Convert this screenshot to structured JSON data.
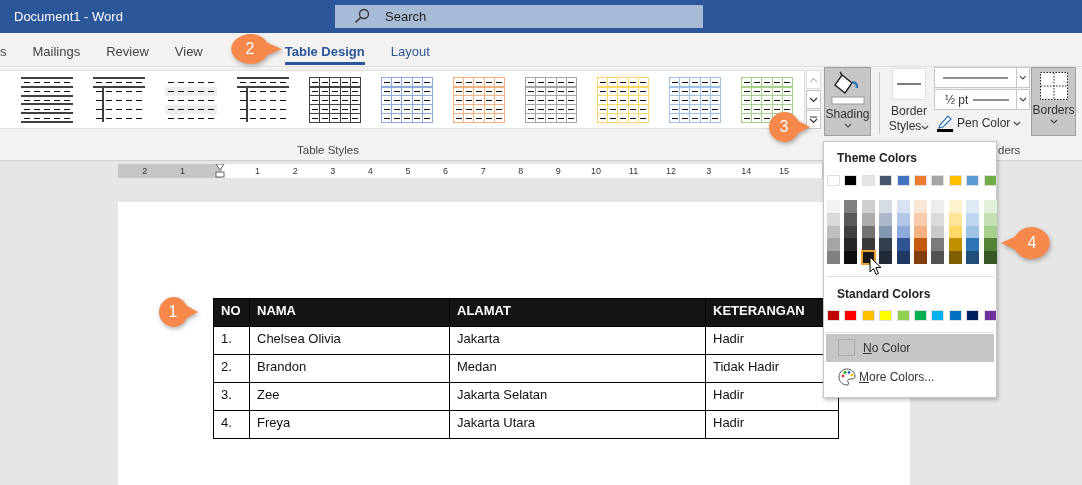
{
  "window": {
    "title": "Document1 - Word"
  },
  "search": {
    "placeholder": "Search"
  },
  "tabs": [
    {
      "label": "s",
      "selected": false,
      "contextual": false
    },
    {
      "label": "Mailings",
      "selected": false,
      "contextual": false
    },
    {
      "label": "Review",
      "selected": false,
      "contextual": false
    },
    {
      "label": "View",
      "selected": false,
      "contextual": false
    },
    {
      "label": "Table Design",
      "selected": true,
      "contextual": true
    },
    {
      "label": "Layout",
      "selected": false,
      "contextual": true
    }
  ],
  "ribbon": {
    "table_styles": {
      "label": "Table Styles",
      "gallery": [
        {
          "kind": "lines",
          "color": "#404040"
        },
        {
          "kind": "header-rule",
          "color": "#404040"
        },
        {
          "kind": "banded",
          "color": "#eeeeee"
        },
        {
          "kind": "header-rule",
          "color": "#404040"
        },
        {
          "kind": "grid",
          "color": "#404040"
        },
        {
          "kind": "grid",
          "color": "#8eaadb"
        },
        {
          "kind": "grid",
          "color": "#f4b183"
        },
        {
          "kind": "grid",
          "color": "#a5a5a5"
        },
        {
          "kind": "grid",
          "color": "#ffd966"
        },
        {
          "kind": "grid",
          "color": "#9dc3e6"
        },
        {
          "kind": "grid",
          "color": "#a8d08d"
        }
      ]
    },
    "shading": {
      "label": "Shading",
      "pressed": true
    },
    "border_styles": {
      "label": "Border Styles"
    },
    "pen_weight": "½ pt",
    "pen_color": {
      "label": "Pen Color"
    },
    "borders": {
      "label": "Borders",
      "pressed": true
    },
    "borders_group_label": "ders"
  },
  "ruler": {
    "numbers": [
      "2",
      "1",
      "1",
      "2",
      "3",
      "4",
      "5",
      "6",
      "7",
      "8",
      "9",
      "10",
      "11",
      "12",
      "3",
      "14",
      "15"
    ]
  },
  "table": {
    "columns": [
      "NO",
      "NAMA",
      "ALAMAT",
      "KETERANGAN"
    ],
    "rows": [
      [
        "1.",
        "Chelsea Olivia",
        "Jakarta",
        "Hadir"
      ],
      [
        "2.",
        "Brandon",
        "Medan",
        "Tidak Hadir"
      ],
      [
        "3.",
        "Zee",
        "Jakarta Selatan",
        "Hadir"
      ],
      [
        "4.",
        "Freya",
        "Jakarta Utara",
        "Hadir"
      ]
    ]
  },
  "shading_menu": {
    "theme_title": "Theme Colors",
    "theme_colors": [
      {
        "color": "#ffffff",
        "selected": false,
        "shades": [
          {
            "color": "#f2f2f2",
            "selected": false
          },
          {
            "color": "#d9d9d9",
            "selected": false
          },
          {
            "color": "#bfbfbf",
            "selected": false
          },
          {
            "color": "#a6a6a6",
            "selected": false
          },
          {
            "color": "#808080",
            "selected": false
          }
        ]
      },
      {
        "color": "#000000",
        "selected": false,
        "shades": [
          {
            "color": "#808080",
            "selected": false
          },
          {
            "color": "#595959",
            "selected": false
          },
          {
            "color": "#404040",
            "selected": false
          },
          {
            "color": "#262626",
            "selected": false
          },
          {
            "color": "#0d0d0d",
            "selected": false
          }
        ]
      },
      {
        "color": "#e7e6e6",
        "selected": false,
        "shades": [
          {
            "color": "#d0cece",
            "selected": false
          },
          {
            "color": "#aeabab",
            "selected": false
          },
          {
            "color": "#757171",
            "selected": false
          },
          {
            "color": "#3b3838",
            "selected": false
          },
          {
            "color": "#181717",
            "selected": true
          }
        ]
      },
      {
        "color": "#44546a",
        "selected": false,
        "shades": [
          {
            "color": "#d6dce4",
            "selected": false
          },
          {
            "color": "#adb9ca",
            "selected": false
          },
          {
            "color": "#8497b0",
            "selected": false
          },
          {
            "color": "#333f4f",
            "selected": false
          },
          {
            "color": "#222a35",
            "selected": false
          }
        ]
      },
      {
        "color": "#4472c4",
        "selected": false,
        "shades": [
          {
            "color": "#d9e2f3",
            "selected": false
          },
          {
            "color": "#b4c6e7",
            "selected": false
          },
          {
            "color": "#8eaadb",
            "selected": false
          },
          {
            "color": "#2f5496",
            "selected": false
          },
          {
            "color": "#1f3864",
            "selected": false
          }
        ]
      },
      {
        "color": "#ed7d31",
        "selected": false,
        "shades": [
          {
            "color": "#fbe5d5",
            "selected": false
          },
          {
            "color": "#f7cbac",
            "selected": false
          },
          {
            "color": "#f4b183",
            "selected": false
          },
          {
            "color": "#c55a11",
            "selected": false
          },
          {
            "color": "#833c0b",
            "selected": false
          }
        ]
      },
      {
        "color": "#a5a5a5",
        "selected": false,
        "shades": [
          {
            "color": "#ededed",
            "selected": false
          },
          {
            "color": "#dbdbdb",
            "selected": false
          },
          {
            "color": "#c9c9c9",
            "selected": false
          },
          {
            "color": "#7b7b7b",
            "selected": false
          },
          {
            "color": "#525252",
            "selected": false
          }
        ]
      },
      {
        "color": "#ffc000",
        "selected": false,
        "shades": [
          {
            "color": "#fff2cc",
            "selected": false
          },
          {
            "color": "#ffe599",
            "selected": false
          },
          {
            "color": "#ffd966",
            "selected": false
          },
          {
            "color": "#bf9000",
            "selected": false
          },
          {
            "color": "#7f6000",
            "selected": false
          }
        ]
      },
      {
        "color": "#5b9bd5",
        "selected": false,
        "shades": [
          {
            "color": "#deebf6",
            "selected": false
          },
          {
            "color": "#bdd7ee",
            "selected": false
          },
          {
            "color": "#9dc3e6",
            "selected": false
          },
          {
            "color": "#2e75b5",
            "selected": false
          },
          {
            "color": "#1f4e79",
            "selected": false
          }
        ]
      },
      {
        "color": "#70ad47",
        "selected": false,
        "shades": [
          {
            "color": "#e2efd9",
            "selected": false
          },
          {
            "color": "#c5e0b3",
            "selected": false
          },
          {
            "color": "#a8d08d",
            "selected": false
          },
          {
            "color": "#538135",
            "selected": false
          },
          {
            "color": "#375623",
            "selected": false
          }
        ]
      }
    ],
    "standard_title": "Standard Colors",
    "standard_colors": [
      {
        "color": "#c00000",
        "selected": false
      },
      {
        "color": "#ff0000",
        "selected": false
      },
      {
        "color": "#ffc000",
        "selected": false
      },
      {
        "color": "#ffff00",
        "selected": false
      },
      {
        "color": "#92d050",
        "selected": false
      },
      {
        "color": "#00b050",
        "selected": false
      },
      {
        "color": "#00b0f0",
        "selected": false
      },
      {
        "color": "#0070c0",
        "selected": false
      },
      {
        "color": "#002060",
        "selected": false
      },
      {
        "color": "#7030a0",
        "selected": false
      }
    ],
    "no_color": {
      "label": "No Color",
      "highlighted": true
    },
    "more_colors": "More Colors..."
  },
  "callouts": [
    {
      "label": "1"
    },
    {
      "label": "2"
    },
    {
      "label": "3"
    },
    {
      "label": "4"
    }
  ]
}
